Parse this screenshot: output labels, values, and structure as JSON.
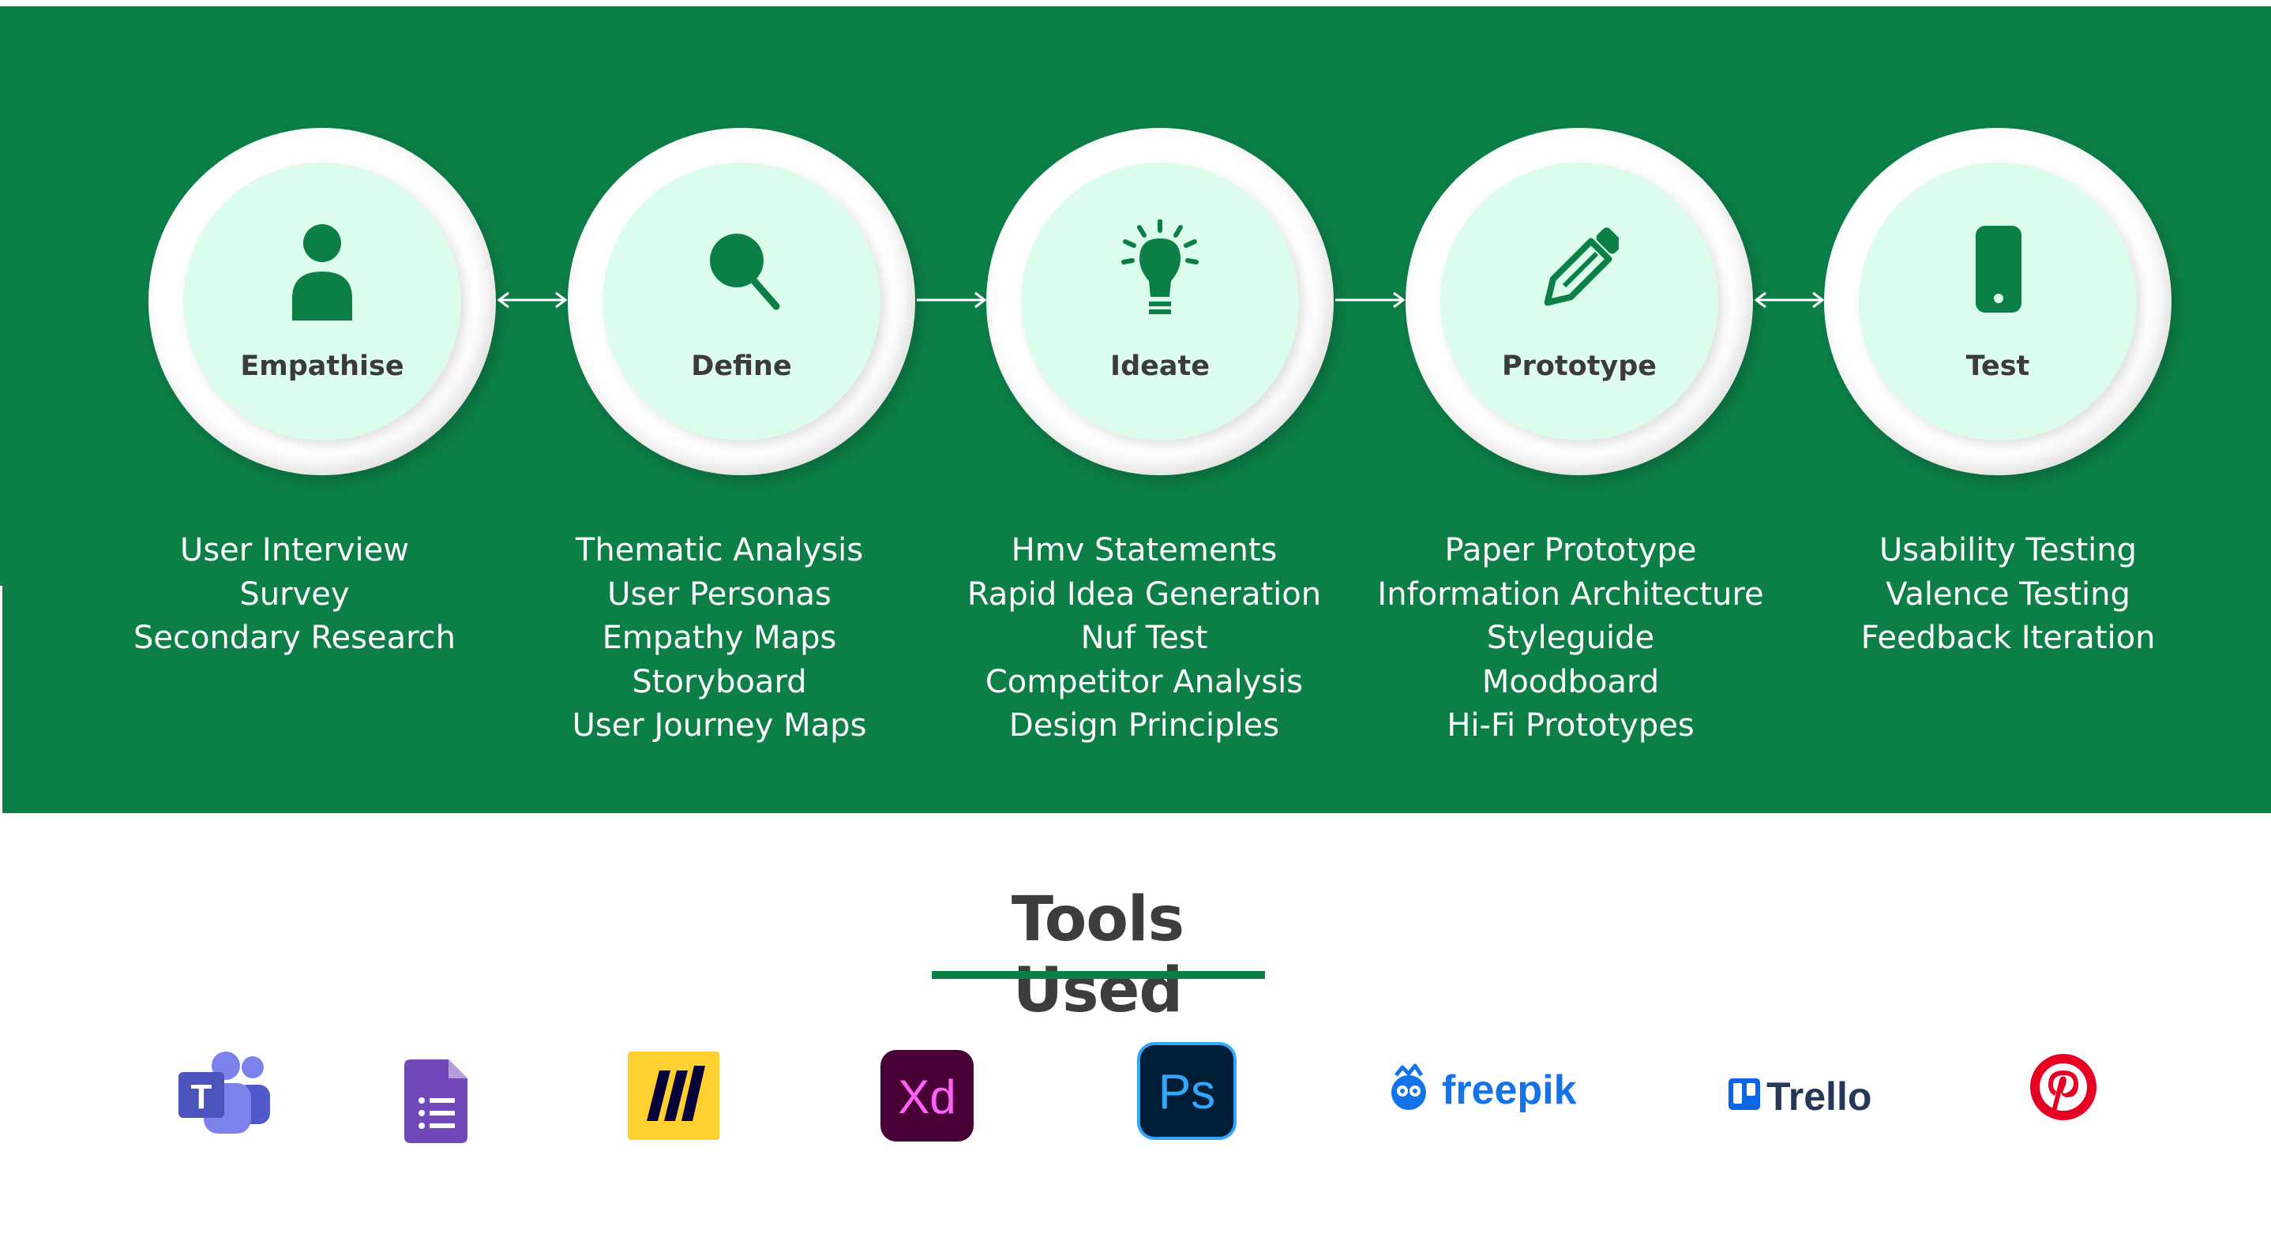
{
  "stages": [
    {
      "label": "Empathise",
      "icon": "person-icon",
      "methods": [
        "User Interview",
        "Survey",
        "Secondary Research"
      ]
    },
    {
      "label": "Define",
      "icon": "magnifier-icon",
      "methods": [
        "Thematic Analysis",
        "User Personas",
        "Empathy Maps",
        "Storyboard",
        "User Journey Maps"
      ]
    },
    {
      "label": "Ideate",
      "icon": "lightbulb-icon",
      "methods": [
        "Hmv Statements",
        "Rapid Idea Generation",
        "Nuf Test",
        "Competitor Analysis",
        "Design Principles"
      ]
    },
    {
      "label": "Prototype",
      "icon": "pencil-icon",
      "methods": [
        "Paper Prototype",
        "Information Architecture",
        "Styleguide",
        "Moodboard",
        "Hi-Fi Prototypes"
      ]
    },
    {
      "label": "Test",
      "icon": "phone-icon",
      "methods": [
        "Usability Testing",
        "Valence Testing",
        "Feedback Iteration"
      ]
    }
  ],
  "connectors": [
    "bidirectional",
    "forward",
    "forward",
    "bidirectional"
  ],
  "tools_section": {
    "title": "Tools Used",
    "tools": [
      {
        "name": "microsoft-teams-logo",
        "glyph": "T"
      },
      {
        "name": "google-forms-logo"
      },
      {
        "name": "miro-logo"
      },
      {
        "name": "adobe-xd-logo",
        "glyph": "Xd"
      },
      {
        "name": "adobe-photoshop-logo",
        "glyph": "Ps"
      },
      {
        "name": "freepik-logo",
        "text": "freepik"
      },
      {
        "name": "trello-logo",
        "text": "Trello"
      },
      {
        "name": "pinterest-logo"
      }
    ]
  },
  "colors": {
    "brand_green": "#0c7f47",
    "circle_fill": "#dcfcec",
    "label_dark": "#3b3b3b",
    "white": "#ffffff"
  }
}
